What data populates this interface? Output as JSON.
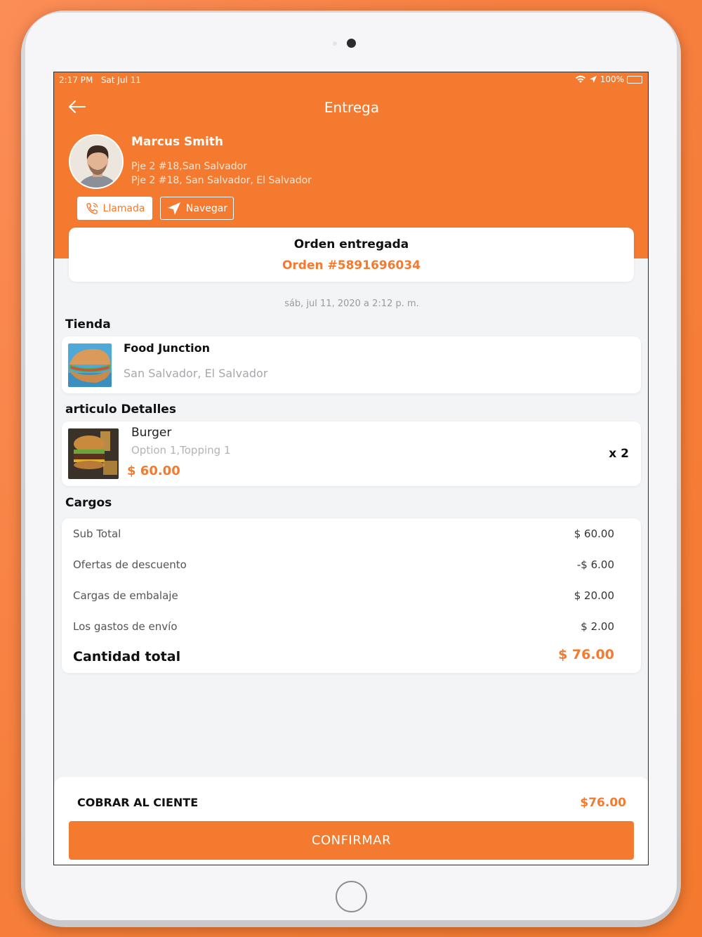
{
  "status_bar": {
    "time": "2:17 PM",
    "date": "Sat Jul 11",
    "battery": "100%"
  },
  "header": {
    "title": "Entrega"
  },
  "customer": {
    "name": "Marcus Smith",
    "address_line1": "Pje 2 #18,San Salvador",
    "address_line2": "Pje 2 #18,  San Salvador,  El Salvador",
    "call_label": "Llamada",
    "navigate_label": "Navegar"
  },
  "order": {
    "status": "Orden entregada",
    "id_label": "Orden #5891696034",
    "date": "sáb, jul 11, 2020 a 2:12 p. m."
  },
  "store_section": {
    "title": "Tienda",
    "name": "Food Junction",
    "location": "San Salvador, El Salvador"
  },
  "items_section": {
    "title": "articulo Detalles",
    "items": [
      {
        "name": "Burger",
        "options": "Option 1,Topping 1",
        "price": "$ 60.00",
        "quantity": "x 2"
      }
    ]
  },
  "charges_section": {
    "title": "Cargos",
    "rows": [
      {
        "label": "Sub Total",
        "value": "$ 60.00"
      },
      {
        "label": "Ofertas de descuento",
        "value": "-$ 6.00"
      },
      {
        "label": "Cargas de embalaje",
        "value": "$ 20.00"
      },
      {
        "label": "Los gastos de envío",
        "value": "$ 2.00"
      }
    ],
    "total_label": "Cantidad total",
    "total_value": "$ 76.00"
  },
  "footer": {
    "collect_label": "COBRAR AL CIENTE",
    "collect_value": "$76.00",
    "confirm_label": "CONFIRMAR"
  },
  "colors": {
    "accent": "#f47a30",
    "background": "#f3f4f6",
    "card": "#ffffff"
  },
  "icons": [
    "back-arrow-icon",
    "wifi-icon",
    "location-arrow-icon",
    "battery-icon",
    "phone-icon",
    "navigation-icon"
  ]
}
